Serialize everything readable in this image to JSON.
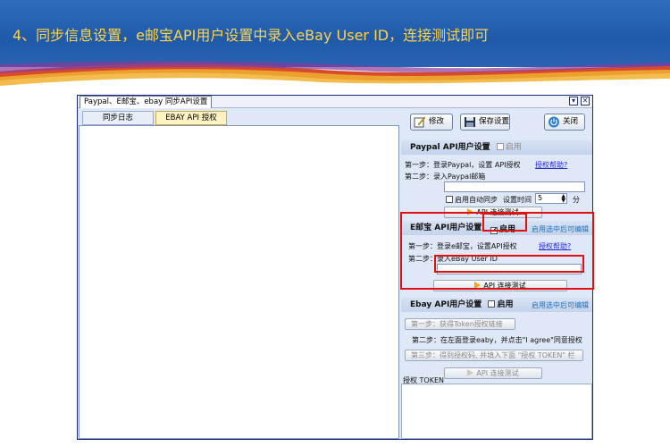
{
  "banner": {
    "title": "4、同步信息设置，e邮宝API用户设置中录入eBay User ID，连接测试即可"
  },
  "window": {
    "title": "Paypal、E邮宝、ebay 同步API设置",
    "min_symbol": "▾",
    "close_symbol": "✕"
  },
  "left_tabs": [
    "同步日志",
    "EBAY API 授权"
  ],
  "toolbar": {
    "edit_label": "修改",
    "save_label": "保存设置",
    "close_label": "关闭"
  },
  "paypal": {
    "header": "Paypal API用户设置",
    "enable_label": "启用",
    "step1": "第一步：登录Paypal，设置 API授权",
    "help_link": "授权帮助?",
    "step2": "第二步：录入Paypal邮箱",
    "email_value": "",
    "auto_sync_label": "启用自动同步",
    "interval_label": "设置时间",
    "interval_value": "5",
    "minute_label": "分",
    "test_button": "API 连接测试"
  },
  "eyoubao": {
    "header": "E邮宝 API用户设置",
    "enable_label": "启用",
    "enable_checked": true,
    "edit_hint": "启用选中后可编辑",
    "step1": "第一步：登录e邮宝，设置API授权",
    "help_link": "授权帮助?",
    "step2": "第二步：录入eBay User ID",
    "userid_value": "",
    "test_button": "API 连接测试"
  },
  "ebay": {
    "header": "Ebay API用户设置",
    "enable_label": "启用",
    "edit_hint": "启用选中后可编辑",
    "step1_button": "第一步：获得Token授权链接",
    "step2": "第二步：在左面登录eaby，并点击\"I agree\"同意授权",
    "step3_button": "第三步：得到授权码, 并填入下面 \"授权 TOKEN\" 栏",
    "token_label": "授权 TOKEN",
    "test_button": "API 连接测试"
  },
  "colors": {
    "banner": "#2f6dbd",
    "title": "#ffd34a",
    "highlight": "#e01010",
    "link": "#2b2bd6"
  }
}
